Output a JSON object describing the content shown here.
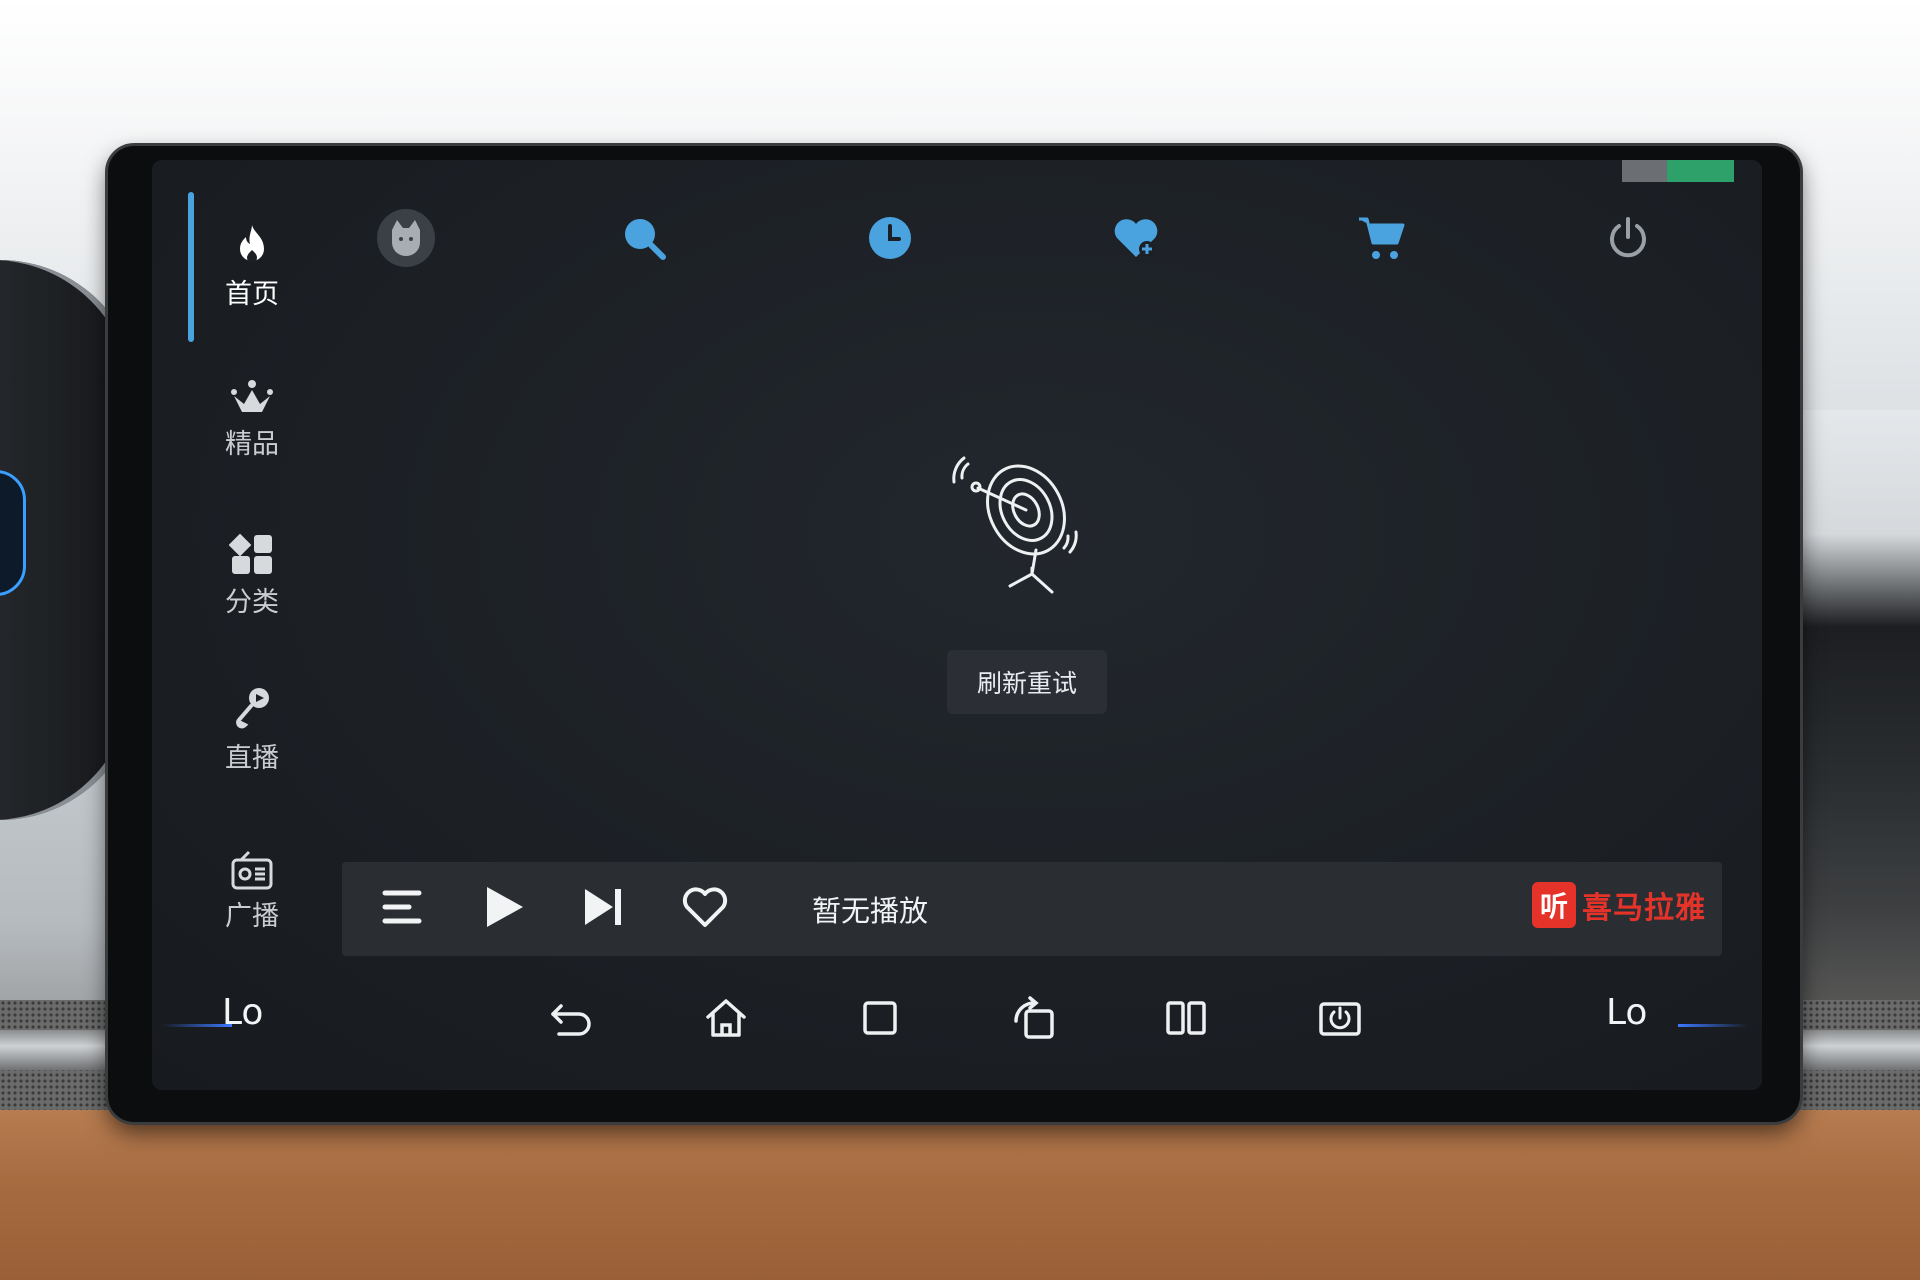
{
  "sidebar": {
    "items": [
      {
        "label": "首页",
        "icon": "flame-icon",
        "active": true
      },
      {
        "label": "精品",
        "icon": "crown-icon",
        "active": false
      },
      {
        "label": "分类",
        "icon": "grid-icon",
        "active": false
      },
      {
        "label": "直播",
        "icon": "microphone-icon",
        "active": false
      },
      {
        "label": "广播",
        "icon": "radio-icon",
        "active": false
      }
    ]
  },
  "topbar": {
    "icons": [
      "avatar-icon",
      "search-icon",
      "history-clock-icon",
      "favorites-heart-icon",
      "cart-icon",
      "power-icon"
    ],
    "accent_color": "#4aa3df"
  },
  "empty_state": {
    "icon": "satellite-dish-icon",
    "refresh_label": "刷新重试"
  },
  "player": {
    "now_playing": "暂无播放",
    "brand_badge": "听",
    "brand_name": "喜马拉雅",
    "brand_color": "#e6332a"
  },
  "navbar": {
    "left_temp": "Lo",
    "right_temp": "Lo",
    "icons": [
      "back-icon",
      "home-icon",
      "recents-icon",
      "rotate-screen-icon",
      "split-screen-icon",
      "screen-off-icon"
    ]
  }
}
